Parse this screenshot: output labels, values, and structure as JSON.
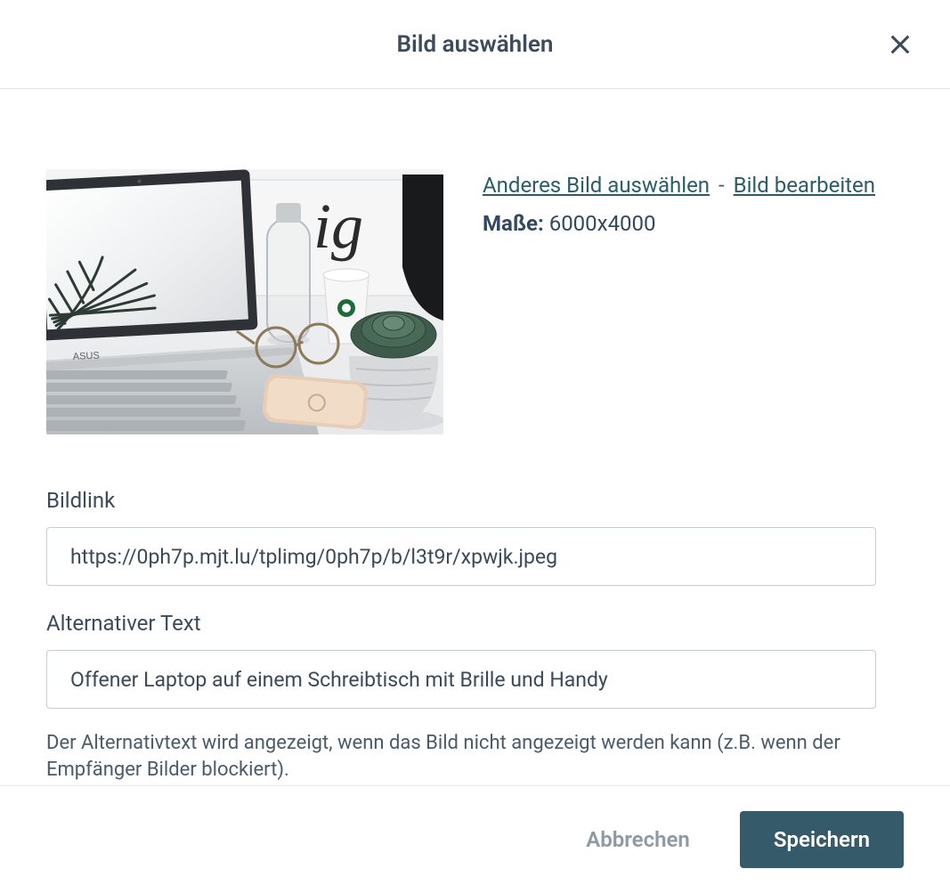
{
  "header": {
    "title": "Bild auswählen"
  },
  "meta": {
    "select_other_label": "Anderes Bild auswählen",
    "edit_image_label": "Bild bearbeiten",
    "dimensions_label": "Maße:",
    "dimensions_value": "6000x4000"
  },
  "fields": {
    "image_link": {
      "label": "Bildlink",
      "value": "https://0ph7p.mjt.lu/tplimg/0ph7p/b/l3t9r/xpwjk.jpeg"
    },
    "alt_text": {
      "label": "Alternativer Text",
      "value": "Offener Laptop auf einem Schreibtisch mit Brille und Handy",
      "help": "Der Alternativtext wird angezeigt, wenn das Bild nicht angezeigt werden kann (z.B. wenn der Empfänger Bilder blockiert)."
    }
  },
  "footer": {
    "cancel_label": "Abbrechen",
    "save_label": "Speichern"
  }
}
